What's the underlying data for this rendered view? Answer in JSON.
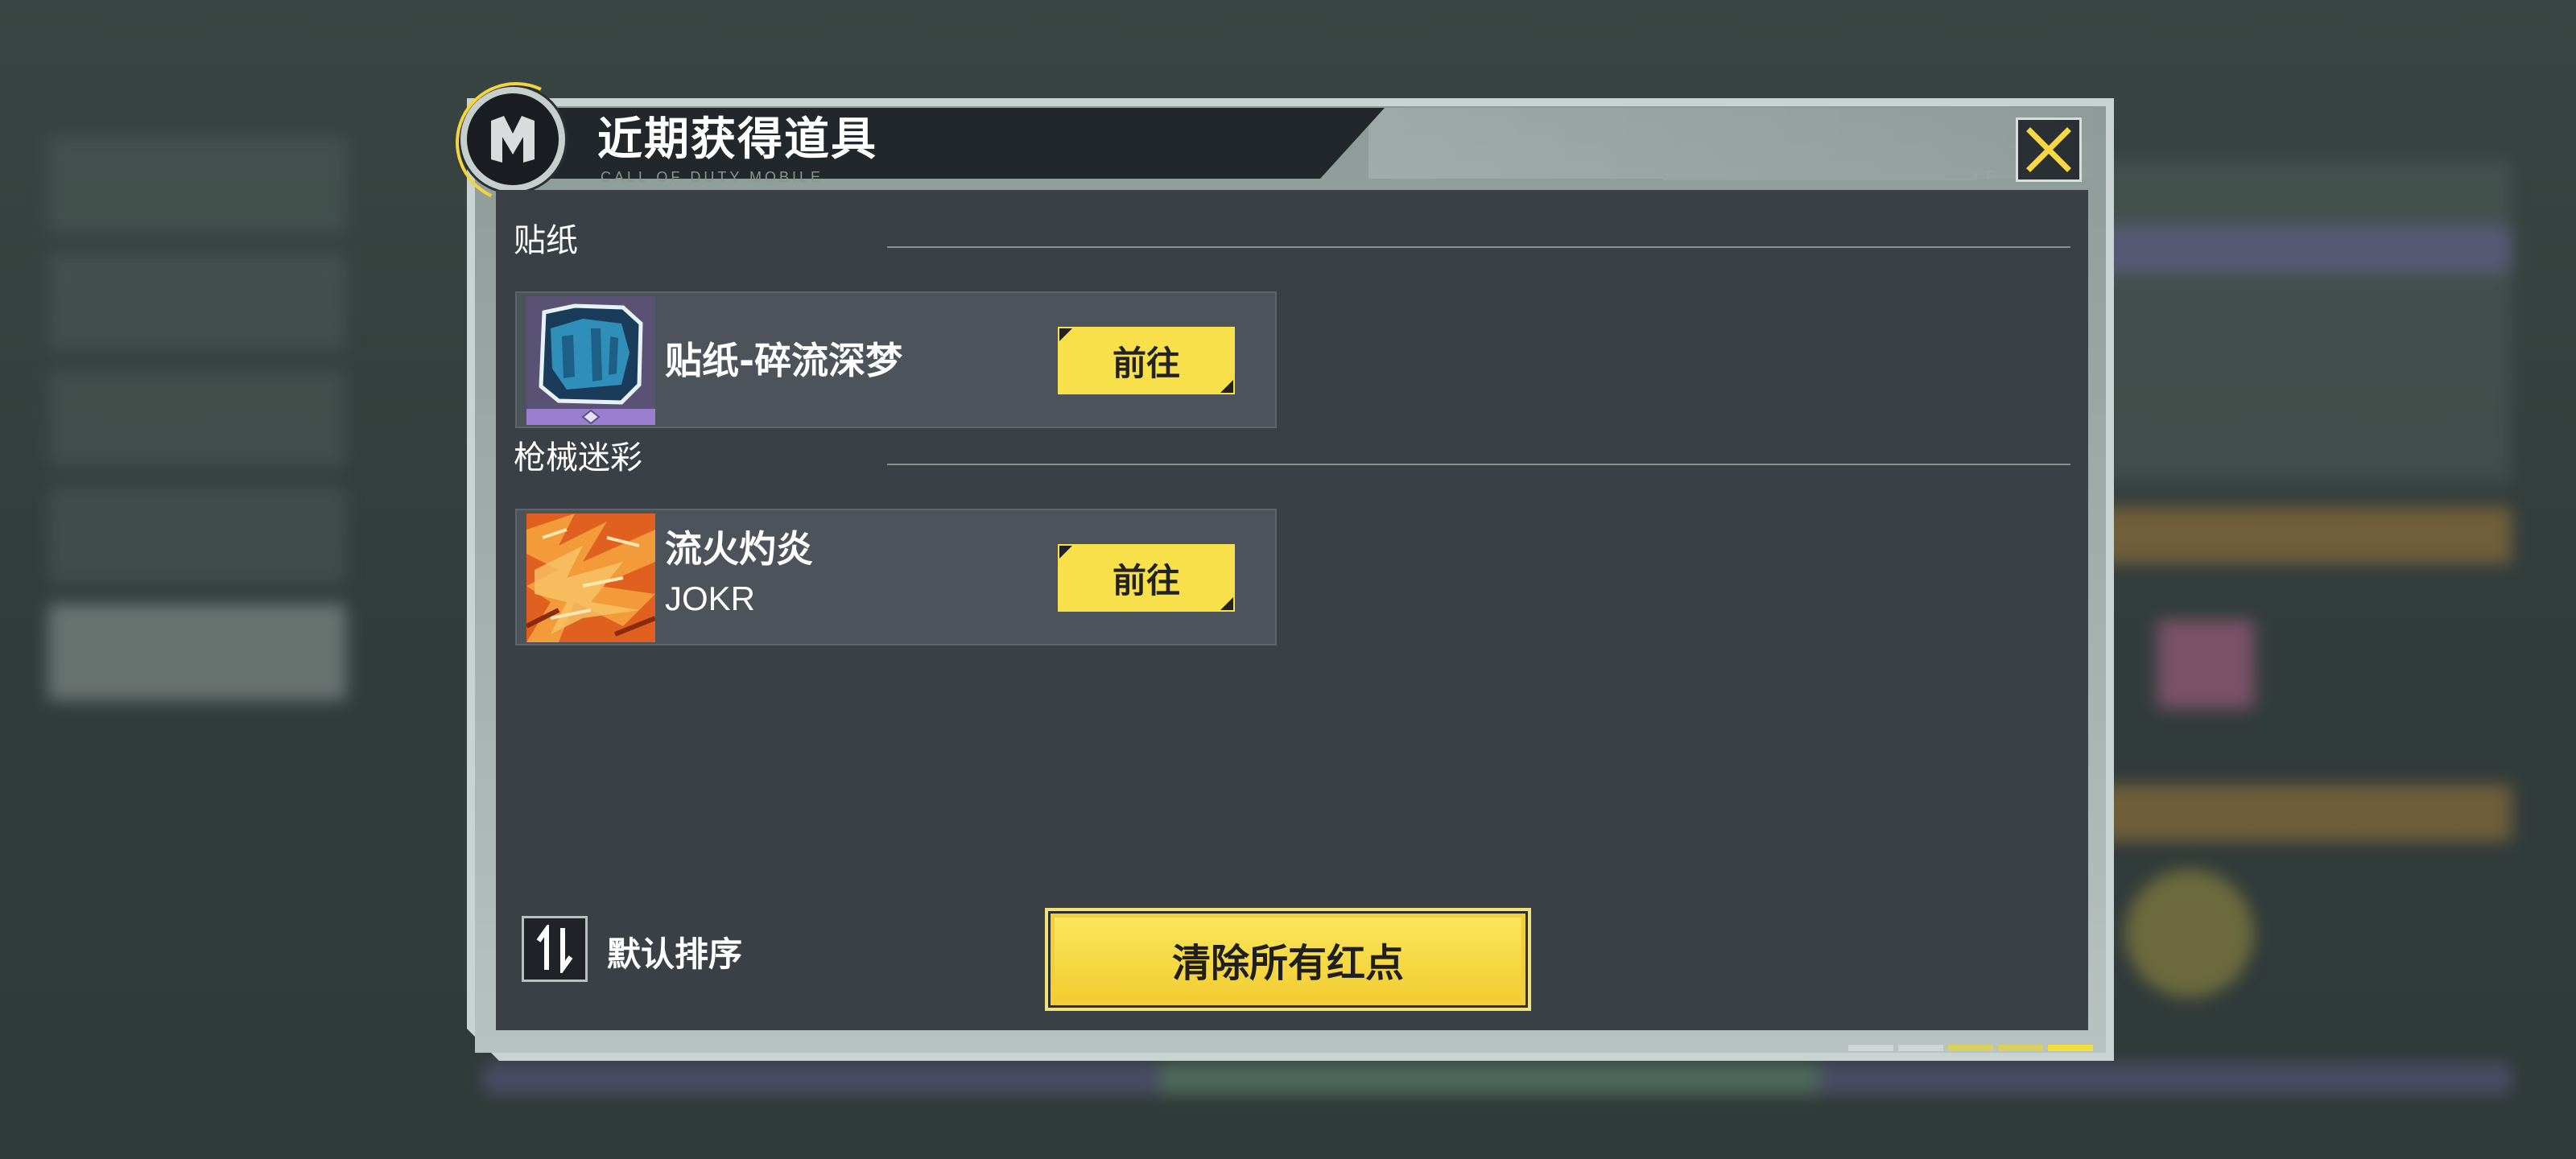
{
  "dialog": {
    "title": "近期获得道具",
    "subtitle": "CALL OF DUTY MOBILE",
    "close_icon": "close-x-icon",
    "accent_color": "#f7e04a"
  },
  "sections": [
    {
      "label": "贴纸",
      "items": [
        {
          "name": "贴纸-碎流深梦",
          "sub": "",
          "button": "前往",
          "thumb": "sticker-thumbnail"
        }
      ]
    },
    {
      "label": "枪械迷彩",
      "items": [
        {
          "name": "流火灼炎",
          "sub": "JOKR",
          "button": "前往",
          "thumb": "camo-thumbnail"
        }
      ]
    }
  ],
  "footer": {
    "sort_icon": "sort-arrows-icon",
    "sort_label": "默认排序",
    "clear_button": "清除所有红点"
  }
}
